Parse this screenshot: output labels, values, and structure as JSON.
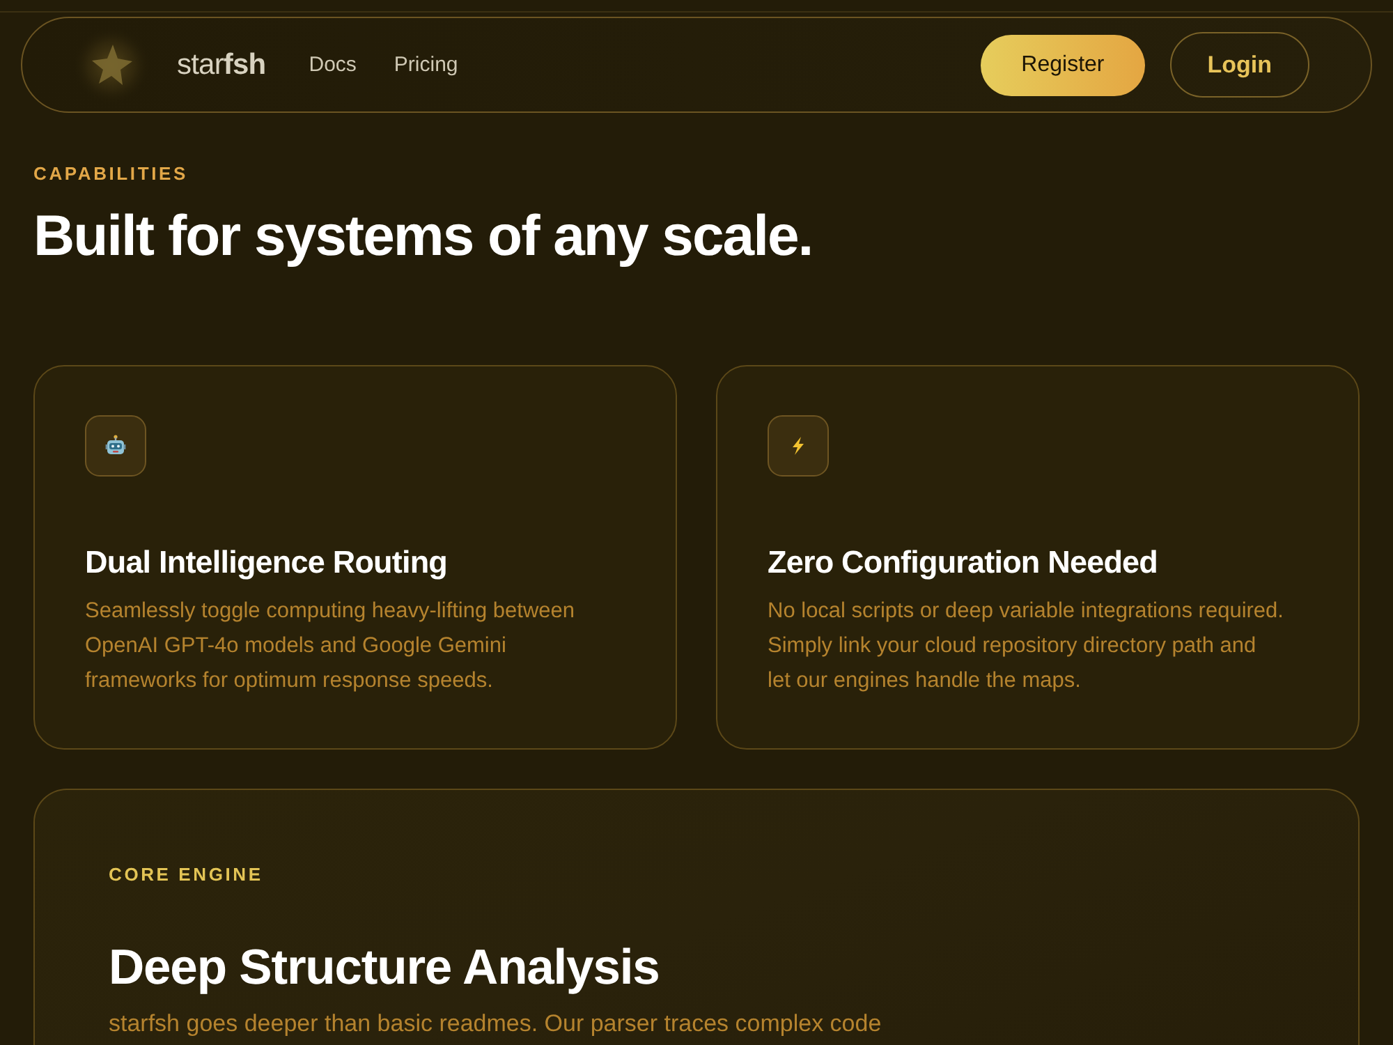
{
  "nav": {
    "brand": "star**fsh**",
    "links": [
      {
        "label": "Docs"
      },
      {
        "label": "Pricing"
      }
    ],
    "buttons": [
      {
        "label": "Register",
        "kind": "primary"
      },
      {
        "label": "Login",
        "kind": "outline"
      }
    ]
  },
  "section": {
    "eyebrow": "CAPABILITIES",
    "title": "Built for systems of any scale."
  },
  "cards": [
    {
      "kind": "robot",
      "title": "Dual Intelligence Routing",
      "text": "Seamlessly toggle computing heavy-lifting between OpenAI GPT-4o models and Google Gemini frameworks for optimum response speeds."
    },
    {
      "kind": "lightning",
      "title": "Zero Configuration Needed",
      "text": "No local scripts or deep variable integrations required. Simply link your cloud repository directory path and let our engines handle the maps."
    }
  ],
  "feature": {
    "eyebrow": "CORE ENGINE",
    "title": "Deep Structure Analysis",
    "text": "starfsh goes deeper than basic readmes. Our parser traces complex code"
  }
}
